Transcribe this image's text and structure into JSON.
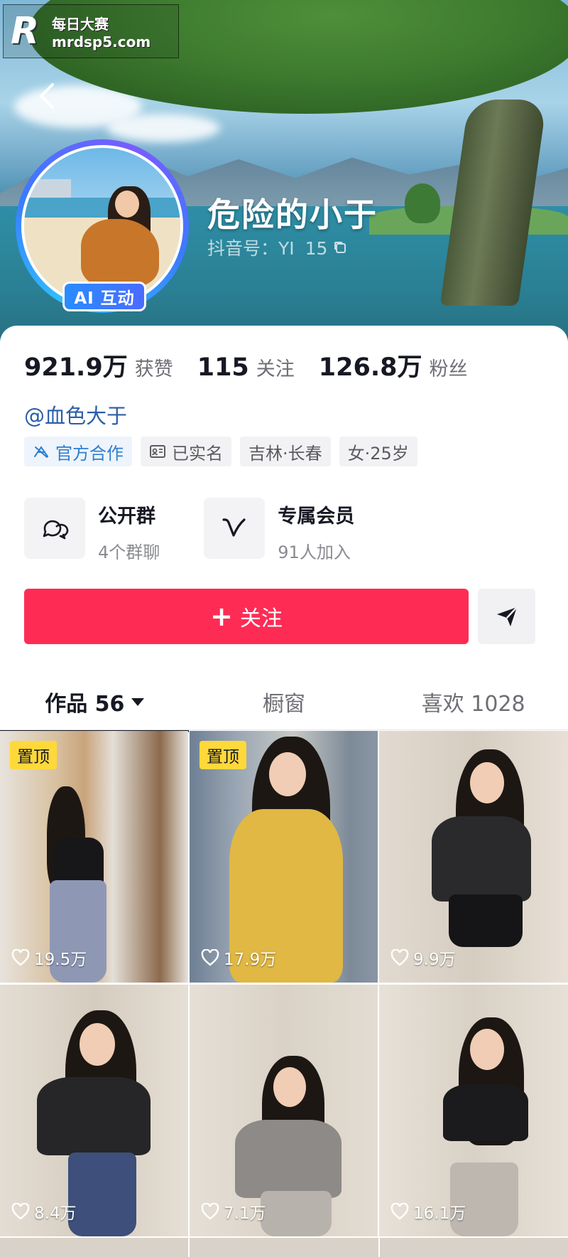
{
  "watermark": {
    "cn": "每日大赛",
    "url": "mrdsp5.com",
    "logo_letter": "R"
  },
  "profile": {
    "nickname": "危险的小于",
    "douyin_id": "抖音号：YI   15",
    "ai_badge": "AI 互动",
    "signature": "@血色大于"
  },
  "stats": [
    {
      "num": "921.9万",
      "label": "获赞"
    },
    {
      "num": "115",
      "label": "关注"
    },
    {
      "num": "126.8万",
      "label": "粉丝"
    }
  ],
  "tags": [
    {
      "label": "官方合作",
      "icon": "official-cooperation-icon"
    },
    {
      "label": "已实名",
      "icon": "id-card-icon"
    },
    {
      "label": "吉林·长春"
    },
    {
      "label": "女·25岁"
    }
  ],
  "features": [
    {
      "title": "公开群",
      "sub": "4个群聊",
      "icon": "chat-bubbles-icon"
    },
    {
      "title": "专属会员",
      "sub": "91人加入",
      "icon": "member-v-icon"
    }
  ],
  "follow_label": "关注",
  "tabs": [
    {
      "label": "作品 56"
    },
    {
      "label": "橱窗"
    },
    {
      "label": "喜欢 1028"
    }
  ],
  "videos": [
    {
      "likes": "19.5万",
      "pinned": "置顶"
    },
    {
      "likes": "17.9万",
      "pinned": "置顶"
    },
    {
      "likes": "9.9万"
    },
    {
      "likes": "8.4万"
    },
    {
      "likes": "7.1万"
    },
    {
      "likes": "16.1万"
    }
  ],
  "colors": {
    "accent": "#fe2c55",
    "link": "#2a5ea8",
    "pin": "#ffd93a"
  }
}
